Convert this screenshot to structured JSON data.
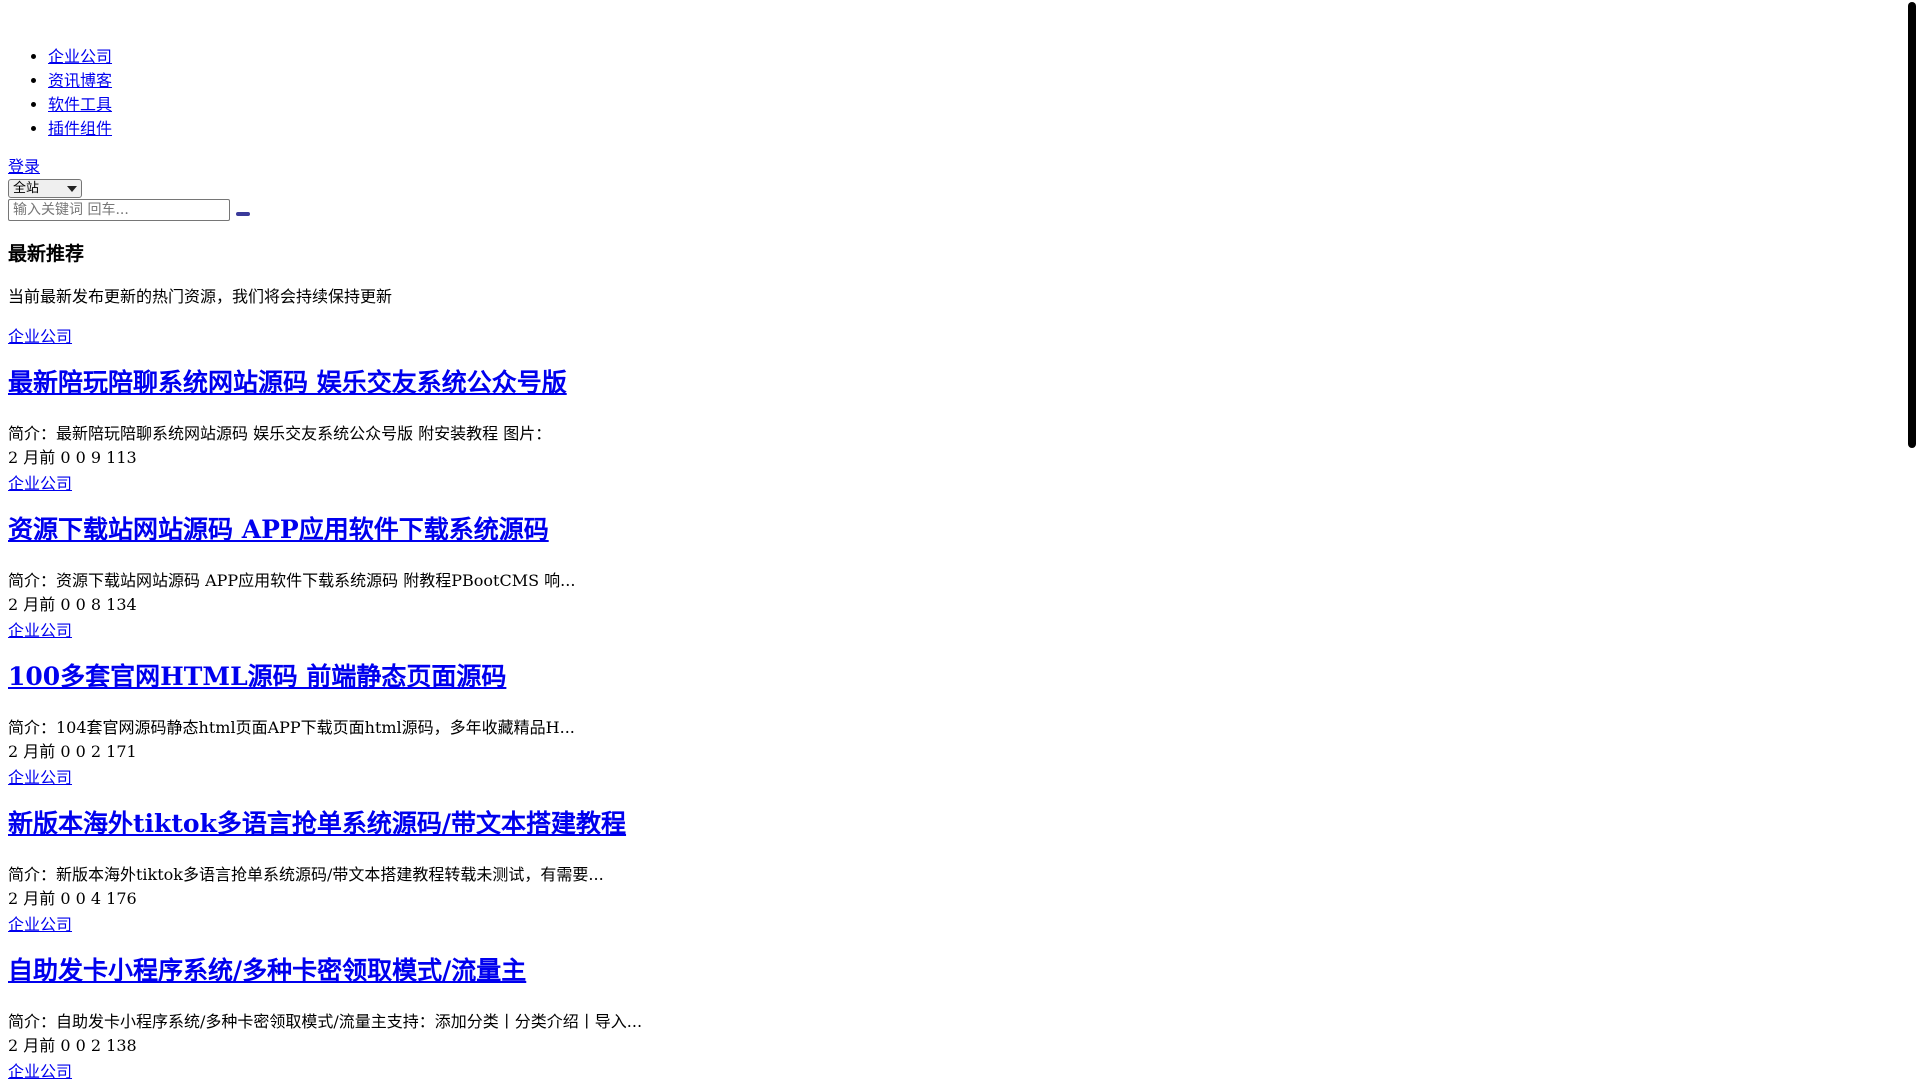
{
  "nav": {
    "items": [
      "企业公司",
      "资讯博客",
      "软件工具",
      "插件组件"
    ]
  },
  "header": {
    "login_label": "登录"
  },
  "search": {
    "scope_value": "全站",
    "placeholder": "输入关键词 回车..."
  },
  "section": {
    "title": "最新推荐",
    "description": "当前最新发布更新的热门资源，我们将会持续保持更新"
  },
  "posts": [
    {
      "category": "企业公司",
      "title": "最新陪玩陪聊系统网站源码 娱乐交友系统公众号版",
      "excerpt": "简介：最新陪玩陪聊系统网站源码 娱乐交友系统公众号版 附安装教程 图片：",
      "meta": "2 月前 0 0 9 113"
    },
    {
      "category": "企业公司",
      "title": "资源下载站网站源码 APP应用软件下载系统源码",
      "excerpt": "简介：资源下载站网站源码 APP应用软件下载系统源码 附教程PBootCMS 响...",
      "meta": "2 月前 0 0 8 134"
    },
    {
      "category": "企业公司",
      "title": "100多套官网HTML源码 前端静态页面源码",
      "excerpt": "简介：104套官网源码静态html页面APP下载页面html源码，多年收藏精品H...",
      "meta": "2 月前 0 0 2 171"
    },
    {
      "category": "企业公司",
      "title": "新版本海外tiktok多语言抢单系统源码/带文本搭建教程",
      "excerpt": "简介：新版本海外tiktok多语言抢单系统源码/带文本搭建教程转载未测试，有需要...",
      "meta": "2 月前 0 0 4 176"
    },
    {
      "category": "企业公司",
      "title": "自助发卡小程序系统/多种卡密领取模式/流量主",
      "excerpt": "简介：自助发卡小程序系统/多种卡密领取模式/流量主支持：添加分类丨分类介绍丨导入...",
      "meta": "2 月前 0 0 2 138"
    },
    {
      "category": "企业公司"
    }
  ]
}
